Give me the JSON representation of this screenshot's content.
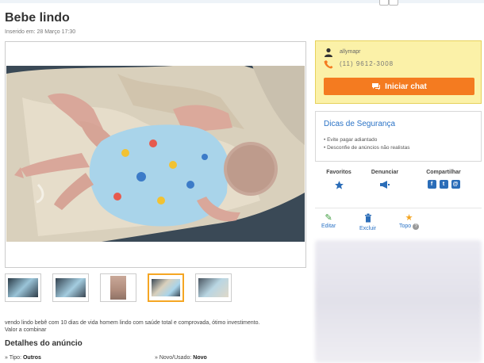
{
  "listing": {
    "title": "Bebe lindo",
    "posted": "Inserido em: 28 Março 17:30",
    "description_line1": "vendo lindo bebê com 10 dias de vida homem lindo com saúde total e comprovada, ótimo investimento.",
    "description_line2": "Valor a combinar",
    "details_title": "Detalhes do anúncio",
    "detail_type_label": "Tipo:",
    "detail_type_value": "Outros",
    "detail_condition_label": "Novo/Usado:",
    "detail_condition_value": "Novo"
  },
  "seller": {
    "name": "allymapr",
    "phone": "(11) 9612-3008",
    "chat_label": "Iniciar chat"
  },
  "safety": {
    "title": "Dicas de Segurança",
    "tips": [
      "• Evite pagar adiantado",
      "• Desconfie de anúncios não realistas"
    ]
  },
  "actions": {
    "favorite": "Favoritos",
    "report": "Denunciar",
    "share": "Compartilhar"
  },
  "tools": {
    "edit": "Editar",
    "delete": "Excluir",
    "top": "Topo"
  },
  "icons": {
    "user": "user-icon",
    "phone": "phone-icon",
    "chat": "chat-icon",
    "favorite": "star-icon",
    "report": "megaphone-icon",
    "facebook": "facebook-icon",
    "twitter": "twitter-icon",
    "email": "email-icon",
    "edit": "pencil-icon",
    "delete": "trash-icon",
    "top": "trophy-icon",
    "help": "help-icon"
  },
  "colors": {
    "accent_orange": "#f47b20",
    "seller_bg": "#fbf1a8",
    "link_blue": "#2b73c6",
    "share_blue": "#2b6db8"
  }
}
